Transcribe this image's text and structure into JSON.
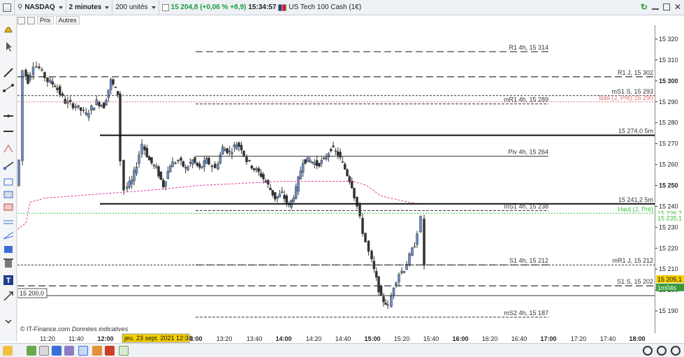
{
  "toolbar": {
    "instrument": "NASDAQ",
    "timeframe": "2 minutes",
    "units": "200 unités",
    "price_change": "15 204,8 (+0,06 % +8,9)",
    "time": "15:34:57",
    "product": "US Tech 100 Cash (1€)"
  },
  "subbar": {
    "price_label": "Prix",
    "others_label": "Autres"
  },
  "chart": {
    "footer_source": "IT-Finance.com",
    "footer_note": "Données indicatives",
    "crosshair_time": "jeu. 23 sept. 2021 12:34",
    "left_box_label": "15 200,0",
    "level_labels": [
      "R1 4h, 15 314",
      "R1 J, 15 302",
      "mS1 S, 15 293",
      "Bas (J, Pré) 15 290",
      "mR1 4h, 15 289",
      "15 274,0 5m",
      "Piv 4h, 15 264",
      "15 241,2 5m",
      "mS1 4h, 15 238",
      "Haut (J, Pré)",
      "S1 4h, 15 212",
      "mR1 J, 15 212",
      "S1 S, 15 202",
      "mS2 4h, 15 187"
    ],
    "colors": {
      "up": "#6b8fc9",
      "down": "#333333",
      "ma": "#e040a0",
      "haut": "#3cbf3c",
      "bas": "#e07070"
    }
  },
  "price_axis": {
    "ticks": [
      "15 320",
      "15 310",
      "15 300",
      "15 290",
      "15 280",
      "15 270",
      "15 260",
      "15 250",
      "15 240",
      "15 230",
      "15 220",
      "15 210",
      "15 200",
      "15 190"
    ],
    "badges": {
      "haut": "15 236,7",
      "haut2": "15 235,1",
      "current": "15 205,1",
      "countdown": "1m04s"
    }
  },
  "time_axis": {
    "labels": [
      "11:20",
      "11:40",
      "12:00",
      "13:00",
      "13:20",
      "13:40",
      "14:00",
      "14:20",
      "14:40",
      "15:00",
      "15:20",
      "15:40",
      "16:00",
      "16:20",
      "16:40",
      "17:00",
      "17:20",
      "17:40",
      "18:00"
    ]
  },
  "chart_data": {
    "type": "candlestick",
    "instrument": "US Tech 100 Cash (1€)",
    "interval": "2 minutes",
    "ylim": [
      15183,
      15325
    ],
    "x": [
      "11:20",
      "11:40",
      "12:00",
      "13:00",
      "13:20",
      "13:40",
      "14:00",
      "14:20",
      "14:40",
      "15:00",
      "15:20",
      "15:40"
    ],
    "price_close": [
      15285,
      15295,
      15285,
      15260,
      15265,
      15268,
      15245,
      15262,
      15250,
      15195,
      15215,
      15205
    ],
    "levels": [
      {
        "label": "R1 4h",
        "value": 15314
      },
      {
        "label": "R1 J",
        "value": 15302
      },
      {
        "label": "mS1 S",
        "value": 15293
      },
      {
        "label": "Bas (J, Pré)",
        "value": 15290
      },
      {
        "label": "mR1 4h",
        "value": 15289
      },
      {
        "label": "5m",
        "value": 15274.0
      },
      {
        "label": "Piv 4h",
        "value": 15264
      },
      {
        "label": "5m",
        "value": 15241.2
      },
      {
        "label": "mS1 4h",
        "value": 15238
      },
      {
        "label": "Haut (J, Pré)",
        "value": 15236.7
      },
      {
        "label": "S1 4h",
        "value": 15212
      },
      {
        "label": "mR1 J",
        "value": 15212
      },
      {
        "label": "S1 S",
        "value": 15202
      },
      {
        "label": "mS2 4h",
        "value": 15187
      }
    ],
    "current_price": 15205.1
  }
}
